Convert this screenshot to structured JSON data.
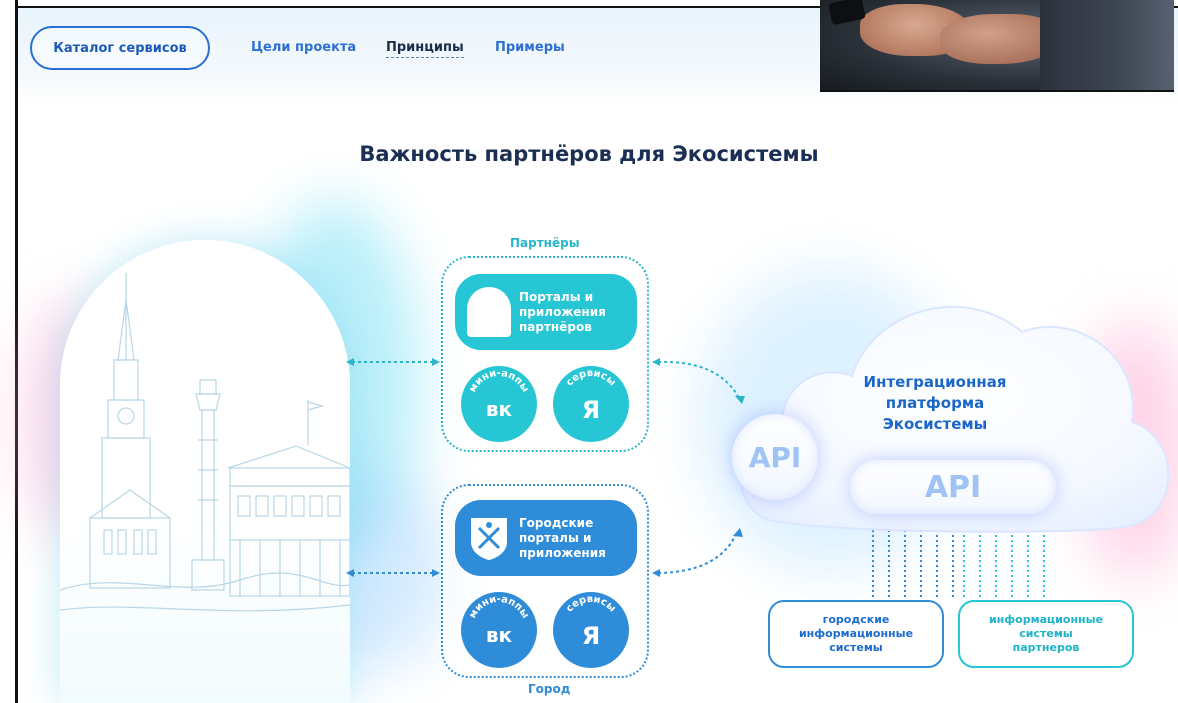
{
  "nav": {
    "catalog_button": "Каталог сервисов",
    "links": [
      "Цели проекта",
      "Принципы",
      "Примеры"
    ]
  },
  "diagram": {
    "title": "Важность партнёров для Экосистемы",
    "partners": {
      "caption": "Партнёры",
      "portal_label": "Порталы и приложения партнёров",
      "mini_apps_label": "мини-аппы",
      "vk_logo": "вк",
      "services_label": "сервисы",
      "yandex_logo": "Я"
    },
    "city": {
      "caption": "Город",
      "portal_label": "Городские порталы и приложения",
      "mini_apps_label": "мини-аппы",
      "vk_logo": "вк",
      "services_label": "сервисы",
      "yandex_logo": "Я"
    },
    "cloud": {
      "title": "Интеграционная платформа Экосистемы",
      "api_left": "API",
      "api_right": "API"
    },
    "systems": {
      "city_systems": "городские информационные системы",
      "partner_systems": "информационные системы партнеров"
    }
  },
  "colors": {
    "accent_blue": "#2f8cd8",
    "accent_teal": "#27c6d4",
    "title_navy": "#1b2f55",
    "cloud_text_blue": "#1b67c9"
  },
  "icons": [
    "gate-icon",
    "city-crest-icon",
    "vk-logo-icon",
    "yandex-logo-icon",
    "arrow-icon",
    "cloud-icon",
    "city-skyline-illustration",
    "photo-hands-phone"
  ]
}
